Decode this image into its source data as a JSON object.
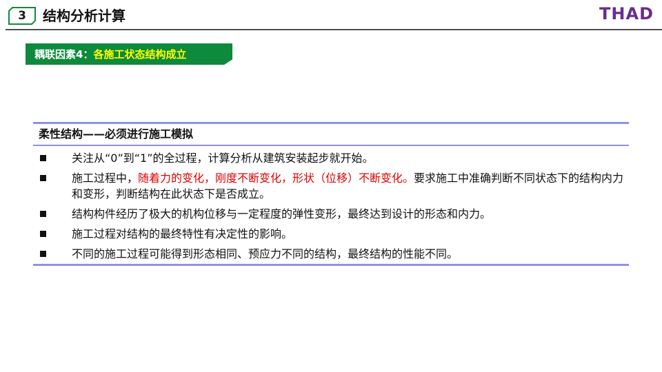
{
  "header": {
    "section_number": "3",
    "section_title": "结构分析计算",
    "logo": "THAD",
    "colors": {
      "logo": "#6a2d8f",
      "rule": "#4d4d4d",
      "badge_border": "#0d8a3b"
    }
  },
  "factor_tag": {
    "prefix": "耦联因素4：",
    "title": "各施工状态结构成立",
    "colors": {
      "background": "#0d8a3b",
      "prefix": "#ffffff",
      "title": "#ffff00"
    }
  },
  "panel": {
    "heading": "柔性结构——必须进行施工模拟",
    "rule_color": "#8f8ff0",
    "items": [
      {
        "text": "关注从“0”到“1”的全过程，计算分析从建筑安装起步就开始。"
      },
      {
        "before": "施工过程中，",
        "highlight": "随着力的变化，刚度不断变化，形状（位移）不断变化。",
        "after": "要求施工中准确判断不同状态下的结构内力和变形，判断结构在此状态下是否成立。",
        "highlight_color": "#e00000"
      },
      {
        "text": "结构构件经历了极大的机构位移与一定程度的弹性变形，最终达到设计的形态和内力。"
      },
      {
        "text": "施工过程对结构的最终特性有决定性的影响。"
      },
      {
        "text": "不同的施工过程可能得到形态相同、预应力不同的结构，最终结构的性能不同。"
      }
    ]
  }
}
